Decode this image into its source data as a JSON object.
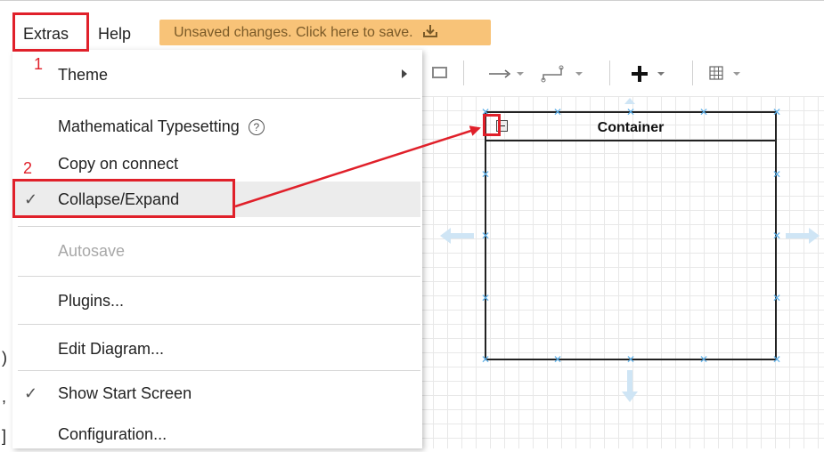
{
  "menubar": {
    "extras_label": "Extras",
    "help_label": "Help",
    "save_banner": "Unsaved changes. Click here to save."
  },
  "annotations": {
    "step1": "1",
    "step2": "2",
    "highlight_color": "#e0202a"
  },
  "extras_menu": {
    "items": [
      {
        "label": "Theme",
        "has_submenu": true
      },
      {
        "label": "Mathematical Typesetting",
        "has_help": true
      },
      {
        "label": "Copy on connect"
      },
      {
        "label": "Collapse/Expand",
        "checked": true,
        "highlighted": true
      },
      {
        "label": "Autosave",
        "disabled": true
      },
      {
        "label": "Plugins..."
      },
      {
        "label": "Edit Diagram..."
      },
      {
        "label": "Show Start Screen",
        "checked": true
      },
      {
        "label": "Configuration..."
      }
    ]
  },
  "diagram": {
    "container_title": "Container",
    "handle_color": "#5aaee8"
  },
  "icons": {
    "save": "download-icon",
    "help": "help-circle-icon",
    "check": "checkmark-icon",
    "collapse": "collapse-minus-icon"
  }
}
